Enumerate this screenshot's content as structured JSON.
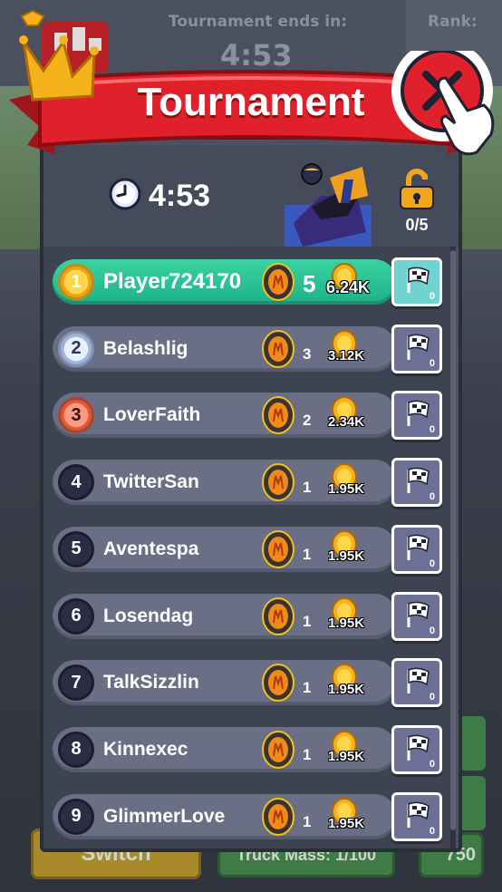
{
  "background": {
    "tournament_ends_label": "Tournament ends in:",
    "tournament_ends_time": "4:53",
    "rank_label": "Rank:",
    "switch_label": "Switch",
    "truck_mass_label": "Truck Mass: 1/100",
    "price_label": "750"
  },
  "banner": {
    "title": "Tournament"
  },
  "header": {
    "timer": "4:53",
    "unlock_progress": "0/5"
  },
  "leaderboard": [
    {
      "rank": "1",
      "name": "Player724170",
      "tires": "5",
      "coins": "6.24K",
      "flags": "0",
      "highlight": true
    },
    {
      "rank": "2",
      "name": "Belashlig",
      "tires": "3",
      "coins": "3.12K",
      "flags": "0"
    },
    {
      "rank": "3",
      "name": "LoverFaith",
      "tires": "2",
      "coins": "2.34K",
      "flags": "0"
    },
    {
      "rank": "4",
      "name": "TwitterSan",
      "tires": "1",
      "coins": "1.95K",
      "flags": "0"
    },
    {
      "rank": "5",
      "name": "Aventespa",
      "tires": "1",
      "coins": "1.95K",
      "flags": "0"
    },
    {
      "rank": "6",
      "name": "Losendag",
      "tires": "1",
      "coins": "1.95K",
      "flags": "0"
    },
    {
      "rank": "7",
      "name": "TalkSizzlin",
      "tires": "1",
      "coins": "1.95K",
      "flags": "0"
    },
    {
      "rank": "8",
      "name": "Kinnexec",
      "tires": "1",
      "coins": "1.95K",
      "flags": "0"
    },
    {
      "rank": "9",
      "name": "GlimmerLove",
      "tires": "1",
      "coins": "1.95K",
      "flags": "0"
    }
  ],
  "colors": {
    "banner_red": "#e0212b",
    "highlight_row": "#22c493",
    "row": "#6a6f86",
    "panel": "#4c5263"
  },
  "icons": {
    "clock": "clock-icon",
    "lock": "unlocked-padlock-icon",
    "tire": "tire-icon",
    "coin": "coin-icon",
    "flag": "checkered-flag-icon",
    "crown": "crown-icon",
    "close": "close-icon",
    "hand": "pointing-hand-icon"
  }
}
